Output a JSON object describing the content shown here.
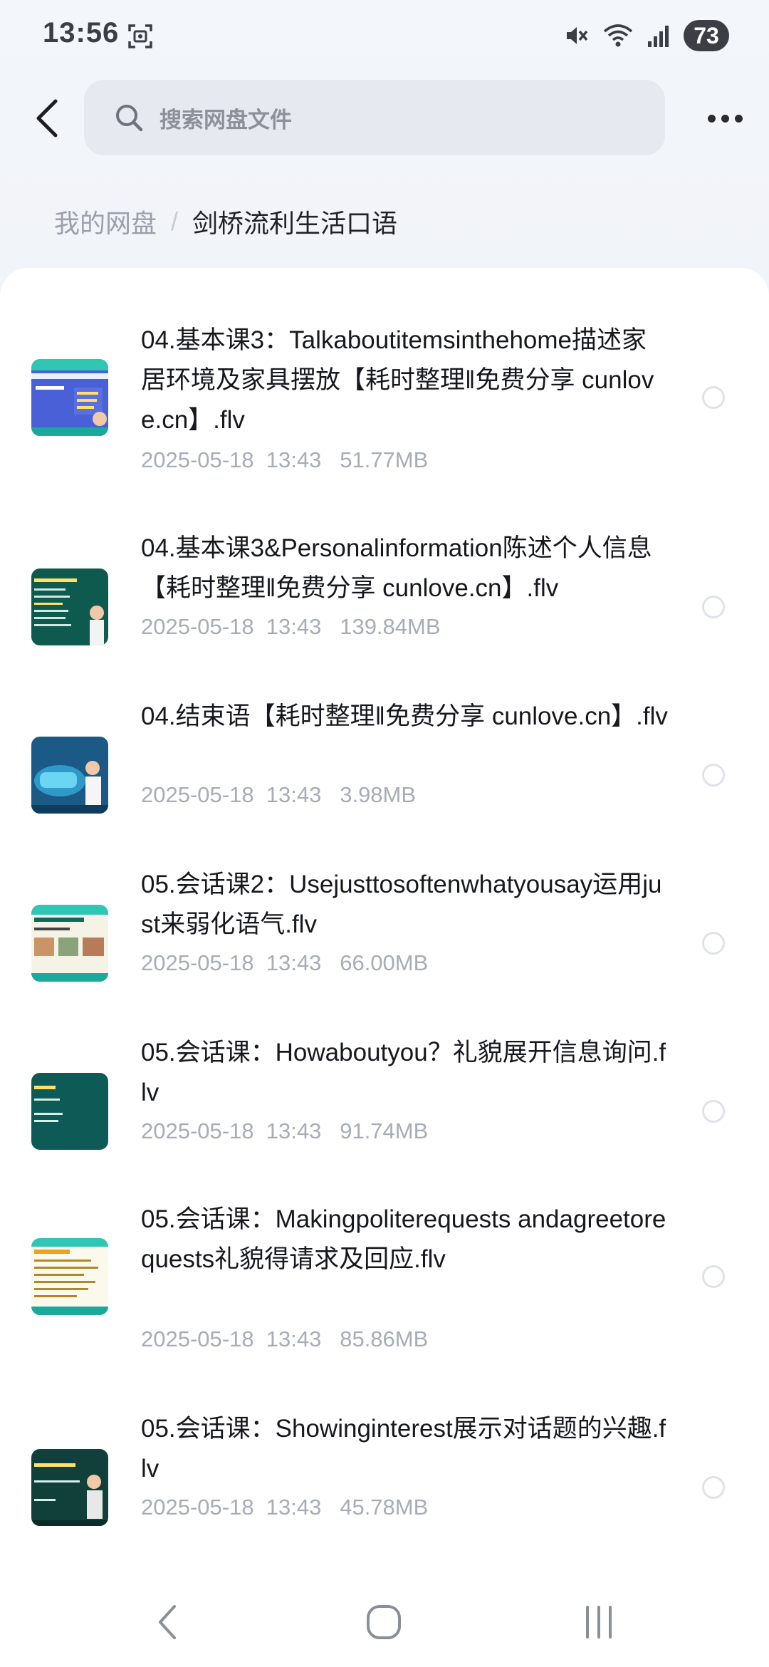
{
  "status_bar": {
    "time": "13:56",
    "battery": "73",
    "icons": [
      "screenshot-icon",
      "mute-icon",
      "wifi-icon",
      "signal-icon"
    ]
  },
  "top_bar": {
    "search_placeholder": "搜索网盘文件",
    "icons": [
      "back-arrow-icon",
      "search-icon",
      "more-dots-icon"
    ]
  },
  "breadcrumb": {
    "root": "我的网盘",
    "separator": "/",
    "current": "剑桥流利生活口语"
  },
  "files": [
    {
      "name": "04.基本课3：Talkaboutitemsinthehome描述家居环境及家具摆放【耗时整理‖免费分享 cunlove.cn】.flv",
      "meta": "2025-05-18  13:43   51.77MB",
      "thumb_color": "#3f56c9"
    },
    {
      "name": "04.基本课3&Personalinformation陈述个人信息【耗时整理‖免费分享 cunlove.cn】.flv",
      "meta": "2025-05-18  13:43   139.84MB",
      "thumb_color": "#0f5a4f"
    },
    {
      "name": "04.结束语【耗时整理‖免费分享 cunlove.cn】.flv",
      "meta": "2025-05-18  13:43   3.98MB",
      "thumb_color": "#1e5f8a"
    },
    {
      "name": "05.会话课2：Usejusttosoftenwhatyousay运用just来弱化语气.flv",
      "meta": "2025-05-18  13:43   66.00MB",
      "thumb_color": "#0f6a5c"
    },
    {
      "name": "05.会话课：Howaboutyou？礼貌展开信息询问.flv",
      "meta": "2025-05-18  13:43   91.74MB",
      "thumb_color": "#0e5a56"
    },
    {
      "name": "05.会话课：Makingpoliterequests andagreetorequests礼貌得请求及回应.flv",
      "meta": "2025-05-18  13:43   85.86MB",
      "thumb_color": "#f5f3e6"
    },
    {
      "name": "05.会话课：Showinginterest展示对话题的兴趣.flv",
      "meta": "2025-05-18  13:43   45.78MB",
      "thumb_color": "#113f3a"
    }
  ],
  "nav_bar": {
    "icons": [
      "nav-back-icon",
      "nav-home-icon",
      "nav-recents-icon"
    ]
  }
}
